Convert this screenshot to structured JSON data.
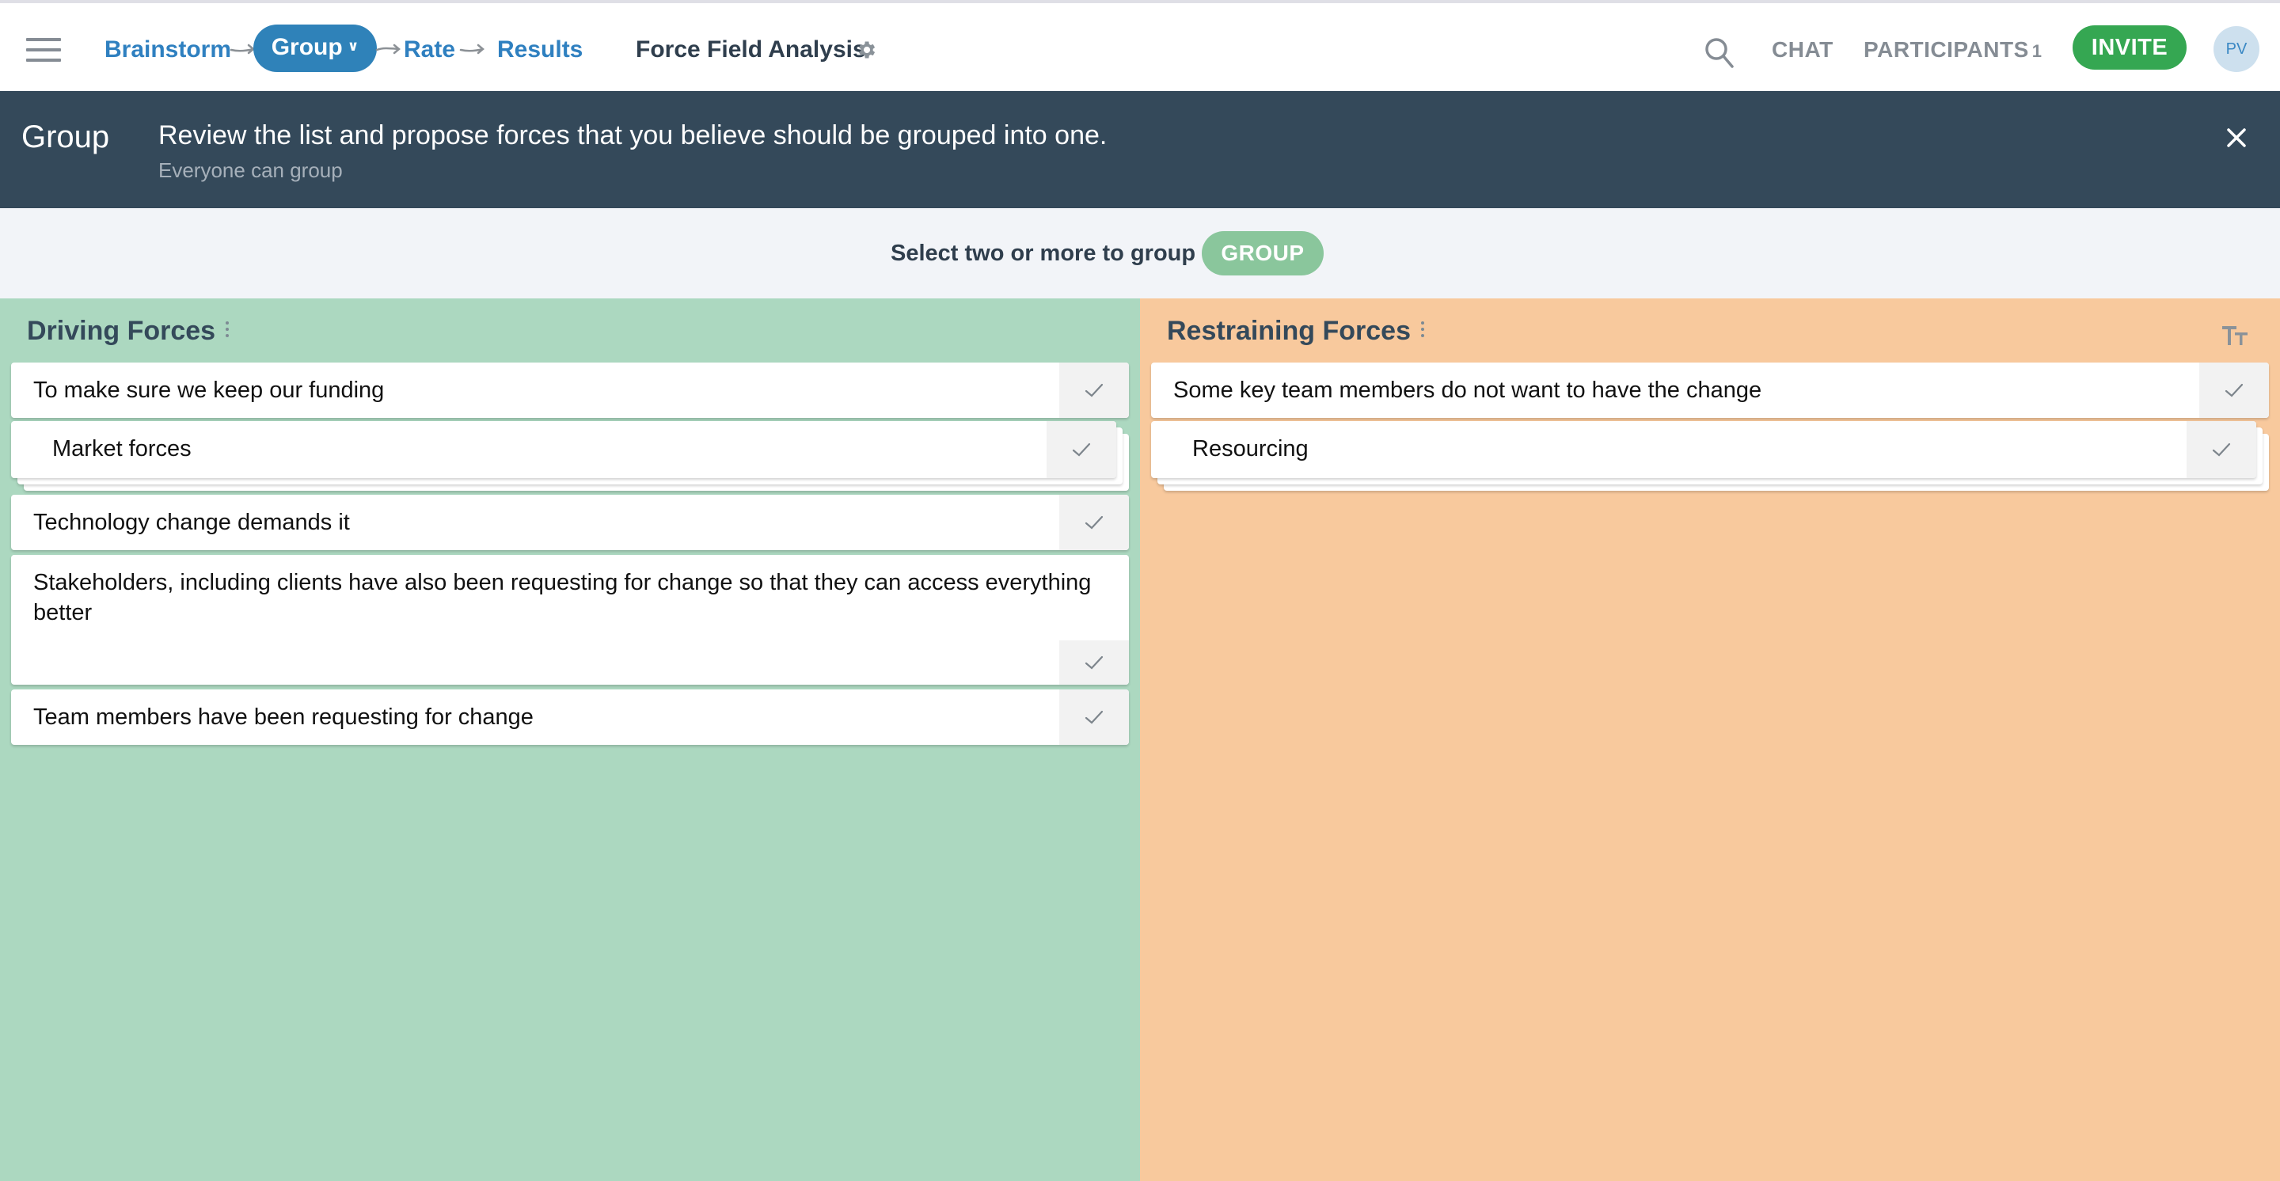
{
  "header": {
    "menu_icon": "hamburger-menu-icon",
    "steps": [
      {
        "label": "Brainstorm",
        "state": "done"
      },
      {
        "label": "Group",
        "state": "active"
      },
      {
        "label": "Rate",
        "state": "upcoming"
      },
      {
        "label": "Results",
        "state": "upcoming"
      }
    ],
    "active_step_chevron": "⌄",
    "session_title": "Force Field Analysis",
    "settings_icon": "gear-icon",
    "search_icon": "search-icon",
    "chat_label": "CHAT",
    "participants_label": "PARTICIPANTS",
    "participants_count": "1",
    "invite_label": "INVITE",
    "avatar_initials": "PV"
  },
  "banner": {
    "title": "Group",
    "message": "Review the list and propose forces that you believe should be grouped into one.",
    "sub_message": "Everyone can group",
    "close_icon": "close-icon"
  },
  "group_bar": {
    "label": "Select two or more to group",
    "button_label": "GROUP",
    "button_enabled": false
  },
  "columns": [
    {
      "title": "Driving Forces",
      "color": "#acd8c0",
      "items": [
        {
          "text": "To make sure we keep our funding",
          "grouped": false
        },
        {
          "text": "Market forces",
          "grouped": true
        },
        {
          "text": "Technology change demands it",
          "grouped": false
        },
        {
          "text": "Stakeholders, including clients have also been requesting for change so that they can access everything better",
          "grouped": false
        },
        {
          "text": "Team members have been requesting for change",
          "grouped": false
        }
      ]
    },
    {
      "title": "Restraining Forces",
      "color": "#f8c99d",
      "items": [
        {
          "text": "Some key team members do not want to have the change",
          "grouped": false
        },
        {
          "text": "Resourcing",
          "grouped": true
        }
      ]
    }
  ],
  "colors": {
    "brand_blue": "#2f82b9",
    "invite_green": "#35a752",
    "group_button_green": "#8ac69c",
    "banner_bg": "#34495a"
  }
}
